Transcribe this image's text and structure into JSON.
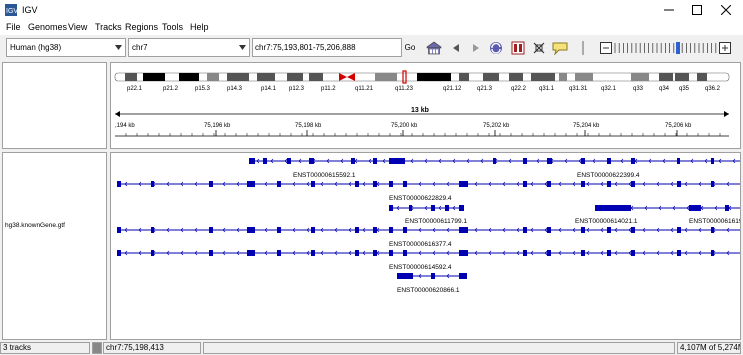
{
  "window": {
    "title": "IGV"
  },
  "menu": [
    "File",
    "Genomes",
    "View",
    "Tracks",
    "Regions",
    "Tools",
    "Help"
  ],
  "toolbar": {
    "genome": "Human (hg38)",
    "chromosome": "chr7",
    "locus": "chr7:75,193,801-75,206,888",
    "go_label": "Go"
  },
  "ideogram": {
    "bands": [
      "p22.1",
      "p21.2",
      "p15.3",
      "p14.3",
      "p14.1",
      "p12.3",
      "p11.2",
      "q11.21",
      "q11.23",
      "q21.12",
      "q21.3",
      "q22.2",
      "q31.1",
      "q31.31",
      "q32.1",
      "q33",
      "q34",
      "q35",
      "q36.2"
    ]
  },
  "ruler": {
    "span_label": "13 kb",
    "ticks": [
      ",194 kb",
      "75,196 kb",
      "75,198 kb",
      "75,200 kb",
      "75,202 kb",
      "75,204 kb",
      "75,206 kb"
    ]
  },
  "track": {
    "name": "hg38.knownGene.gtf",
    "labels": [
      "ENST00000615592.1",
      "ENST00000622399.4",
      "ENST00000622829.4",
      "ENST00000611799.1",
      "ENST00000614021.1",
      "ENST0000061619",
      "ENST00000616377.4",
      "ENST00000614592.4",
      "ENST00000620866.1"
    ]
  },
  "status": {
    "tracks": "3 tracks",
    "position": "chr7:75,198,413",
    "memory": "4,107M of 5,274M"
  },
  "colors": {
    "feature": "#0000b2",
    "centromere": "#d40000"
  }
}
